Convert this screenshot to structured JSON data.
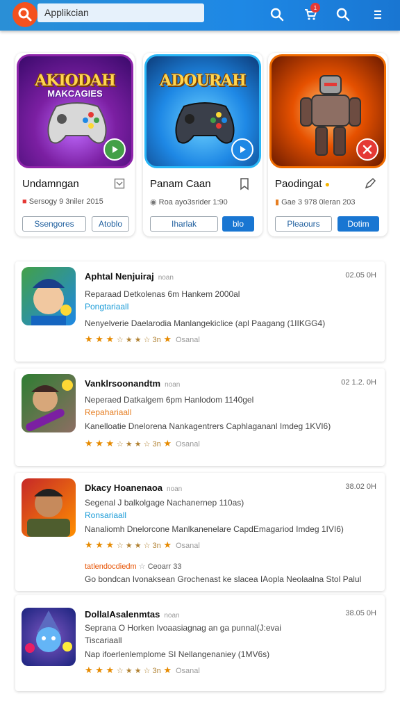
{
  "search": {
    "value": "Applikcian"
  },
  "header": {
    "cart_badge": "1"
  },
  "featured": [
    {
      "art_title": "AKIODAH",
      "art_sub": "MAKCAGIES",
      "name": "Undamngan",
      "meta": "Sersogy 9 3niler 2015",
      "btn1": "Ssengores",
      "btn2": "Atoblo"
    },
    {
      "art_title": "ADOURAH",
      "art_sub": "",
      "name": "Panam Caan",
      "meta": "Roa ayo3srider 1:90",
      "btn1": "Iharlak",
      "btn2": "blo"
    },
    {
      "art_title": "",
      "art_sub": "",
      "name": "Paodingat",
      "meta": "Gae 3 978 0leran 203",
      "btn1": "Pleaours",
      "btn2": "Dotim"
    }
  ],
  "list": [
    {
      "title": "Aphtal Nenjuiraj",
      "tag": "noan",
      "date": "02.05 0H",
      "line1": "Reparaad Detkolenas 6m Hankem 2000al",
      "category": "Pongtariaall",
      "category_color": "#1a9bd7",
      "line2": "Nenyelverie Daelarodia Manlangekiclice (apl Paagang (1IIKGG4)",
      "rating_label": "Osanal"
    },
    {
      "title": "Vanklrsoonandtm",
      "tag": "noan",
      "date": "02 1.2. 0H",
      "line1": "Neperaed Datkalgem 6pm Hanlodom 1140gel",
      "category": "Repahariaall",
      "category_color": "#e67e22",
      "line2": "Kanelloatie Dnelorena Nankagentrers Caphlagananl Imdeg 1KVI6)",
      "rating_label": "Osanal"
    },
    {
      "title": "Dkacy Hoanenaoa",
      "tag": "noan",
      "date": "38.02 0H",
      "line1": "Segenal J balkolgage Nachanernep 110as)",
      "category": "Ronsariaall",
      "category_color": "#1a9bd7",
      "line2": "Nanaliomh Dnelorcone Manlkanenelare CapdEmagariod Imdeg 1IVI6)",
      "rating_label": "Osanal",
      "extra_label": "tatlendocdiedm",
      "extra_sub": "Ceoarr 33",
      "extra_line": "Go bondcan Ivonaksean Grochenast ke slacea IAopla Neolaalna Stol Palul"
    },
    {
      "title": "DollaIAsalenmtas",
      "tag": "noan",
      "date": "38.05 0H",
      "line1": "Seprana O Horken Ivoaasiagnag an ga punnal(J:evai",
      "category": "Tiscariaall",
      "category_color": "#444444",
      "line2": "Nap ifoerlenlemplome SI Nellangenaniey (1MV6s)",
      "rating_label": "Osanal"
    }
  ],
  "rating": {
    "stars": "★ ★ ★",
    "half": "☆ ★ ★ ☆ 3n",
    "star_single": "★",
    "value_fraction": 0.6
  }
}
